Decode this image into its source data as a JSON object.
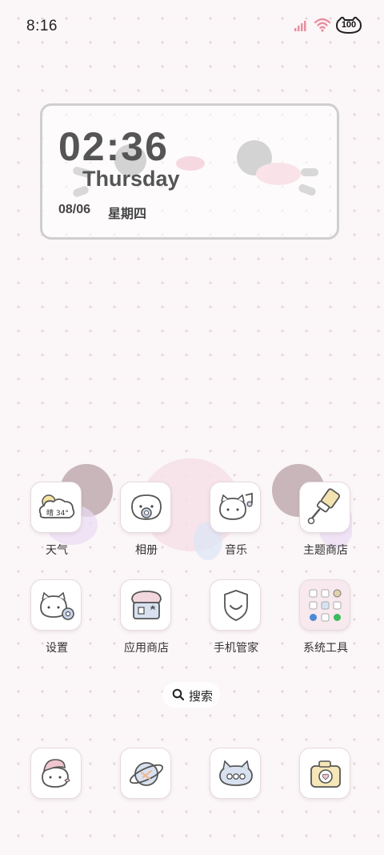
{
  "status_bar": {
    "time": "8:16",
    "battery_level": "100",
    "icons": [
      "signal-icon",
      "wifi-icon",
      "battery-icon"
    ],
    "accent_color": "#e88f9f"
  },
  "clock_widget": {
    "time": "02:36",
    "day": "Thursday",
    "date": "08/06",
    "weekday": "星期四"
  },
  "weather_icon_text": "晴 34°",
  "apps": [
    {
      "label": "天气",
      "icon": "weather-icon"
    },
    {
      "label": "相册",
      "icon": "gallery-icon"
    },
    {
      "label": "音乐",
      "icon": "music-icon"
    },
    {
      "label": "主题商店",
      "icon": "theme-store-icon"
    },
    {
      "label": "设置",
      "icon": "settings-icon"
    },
    {
      "label": "应用商店",
      "icon": "app-store-icon"
    },
    {
      "label": "手机管家",
      "icon": "phone-manager-icon"
    },
    {
      "label": "系统工具",
      "icon": "system-tools-folder-icon"
    }
  ],
  "search": {
    "label": "搜索",
    "icon": "search-icon"
  },
  "dock": [
    {
      "icon": "contacts-icon"
    },
    {
      "icon": "browser-icon"
    },
    {
      "icon": "messages-icon"
    },
    {
      "icon": "camera-icon"
    }
  ],
  "colors": {
    "background": "#fbf6f7",
    "dot": "#e7d5d9",
    "widget_border": "#cfcfcf",
    "text_dark": "#555555"
  }
}
